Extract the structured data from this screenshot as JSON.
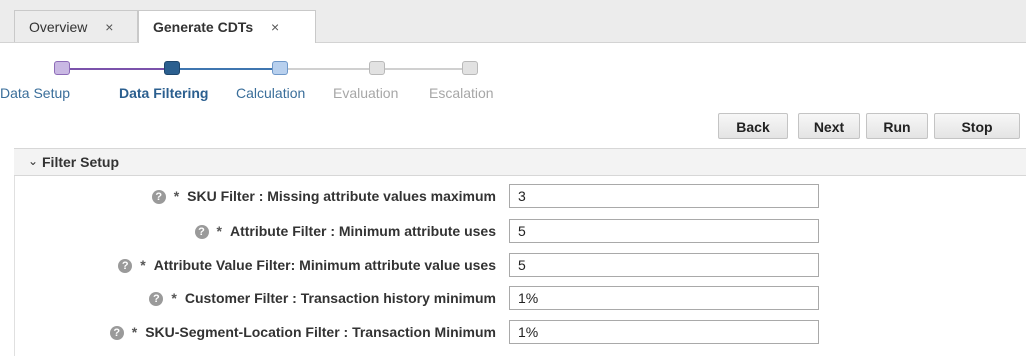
{
  "tabs": [
    {
      "label": "Overview",
      "close": "×"
    },
    {
      "label": "Generate CDTs",
      "close": "×"
    }
  ],
  "train": {
    "steps": [
      {
        "label": "Data Setup",
        "state": "visited"
      },
      {
        "label": "Data Filtering",
        "state": "current"
      },
      {
        "label": "Calculation",
        "state": "next"
      },
      {
        "label": "Evaluation",
        "state": "disabled"
      },
      {
        "label": "Escalation",
        "state": "disabled"
      }
    ]
  },
  "buttons": {
    "back": "Back",
    "next": "Next",
    "run": "Run",
    "stop": "Stop"
  },
  "section": {
    "chevron": "⌄",
    "title": "Filter Setup"
  },
  "fields": [
    {
      "label": "SKU Filter : Missing attribute values maximum",
      "value": "3"
    },
    {
      "label": "Attribute Filter : Minimum attribute uses",
      "value": "5"
    },
    {
      "label": "Attribute Value Filter: Minimum attribute value uses",
      "value": "5"
    },
    {
      "label": "Customer Filter : Transaction history minimum",
      "value": "1%"
    },
    {
      "label": "SKU-Segment-Location Filter : Transaction Minimum",
      "value": "1%"
    }
  ],
  "colors": {
    "visited": "#c9b8e3",
    "visited_border": "#8e6cb8",
    "current": "#2b5f8f",
    "next": "#b8d0ee",
    "next_border": "#6f98c9",
    "disabled": "#e2e2e2",
    "disabled_border": "#b9b9b9",
    "label_active": "#3a6e9a",
    "label_disabled": "#a7a7a7"
  }
}
